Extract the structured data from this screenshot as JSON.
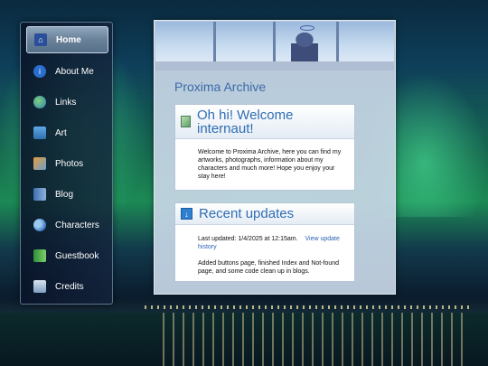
{
  "nav": {
    "items": [
      {
        "label": "Home",
        "icon": "home-icon"
      },
      {
        "label": "About Me",
        "icon": "info-icon"
      },
      {
        "label": "Links",
        "icon": "globe-icon"
      },
      {
        "label": "Art",
        "icon": "monitor-icon"
      },
      {
        "label": "Photos",
        "icon": "photos-icon"
      },
      {
        "label": "Blog",
        "icon": "book-icon"
      },
      {
        "label": "Characters",
        "icon": "users-icon"
      },
      {
        "label": "Guestbook",
        "icon": "guestbook-icon"
      },
      {
        "label": "Credits",
        "icon": "credits-icon"
      }
    ],
    "active_index": 0
  },
  "main": {
    "site_title": "Proxima Archive",
    "welcome": {
      "heading": "Oh hi! Welcome internaut!",
      "body": "Welcome to Proxima Archive, here you can find my artworks, photographs, information about my characters and much more! Hope you enjoy your stay here!"
    },
    "updates": {
      "heading": "Recent updates",
      "last_updated": "Last updated: 1/4/2025 at 12:15am.",
      "history_link": "View update history",
      "body": "Added buttons page, finished Index and Not-found page, and some code clean up in blogs."
    }
  },
  "colors": {
    "accent": "#2f6db3",
    "link": "#2d63b5",
    "sidebar_bg": "#0f1c32"
  }
}
